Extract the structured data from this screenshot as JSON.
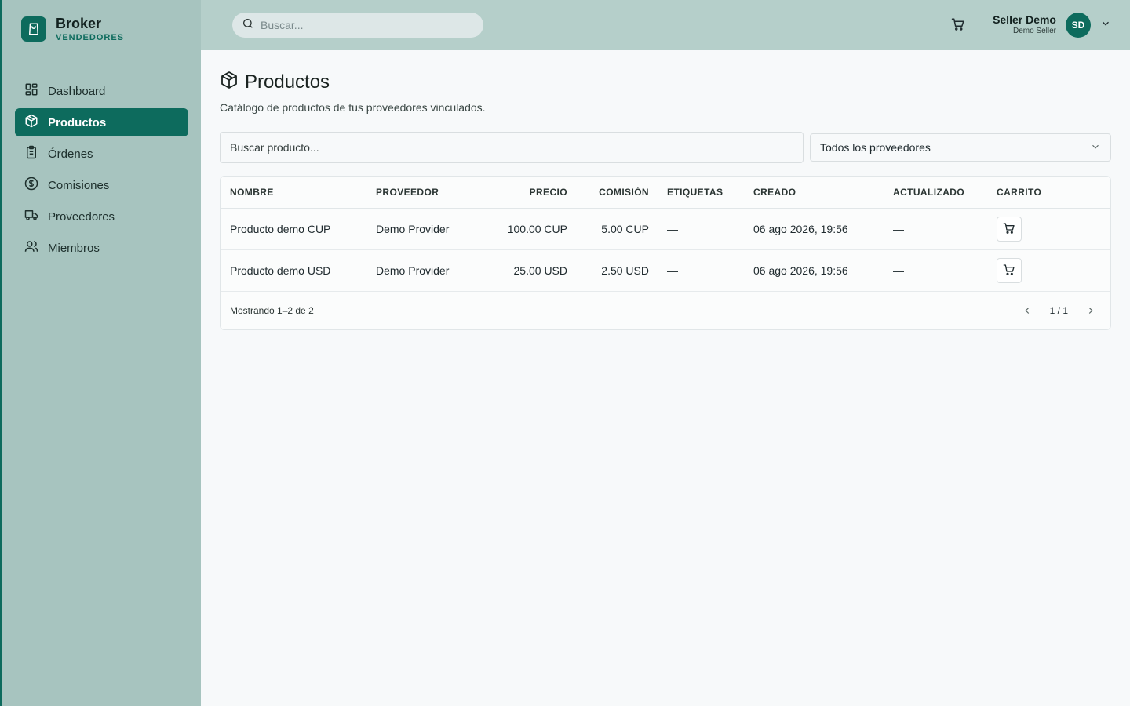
{
  "brand": {
    "name": "Broker",
    "subtitle": "VENDEDORES"
  },
  "sidebar": {
    "items": [
      {
        "label": "Dashboard",
        "icon": "dashboard-icon",
        "active": false
      },
      {
        "label": "Productos",
        "icon": "package-icon",
        "active": true
      },
      {
        "label": "Órdenes",
        "icon": "clipboard-icon",
        "active": false
      },
      {
        "label": "Comisiones",
        "icon": "dollar-circle-icon",
        "active": false
      },
      {
        "label": "Proveedores",
        "icon": "truck-icon",
        "active": false
      },
      {
        "label": "Miembros",
        "icon": "users-icon",
        "active": false
      }
    ]
  },
  "topbar": {
    "search_placeholder": "Buscar...",
    "user": {
      "name": "Seller Demo",
      "role": "Demo Seller",
      "initials": "SD"
    }
  },
  "page": {
    "title": "Productos",
    "description": "Catálogo de productos de tus proveedores vinculados."
  },
  "filters": {
    "search_placeholder": "Buscar producto...",
    "provider_select": "Todos los proveedores"
  },
  "table": {
    "headers": {
      "name": "NOMBRE",
      "provider": "PROVEEDOR",
      "price": "PRECIO",
      "commission": "COMISIÓN",
      "tags": "ETIQUETAS",
      "created": "CREADO",
      "updated": "ACTUALIZADO",
      "cart": "CARRITO"
    },
    "rows": [
      {
        "name": "Producto demo CUP",
        "provider": "Demo Provider",
        "price": "100.00 CUP",
        "commission": "5.00 CUP",
        "tags": "—",
        "created": "06 ago 2026, 19:56",
        "updated": "—"
      },
      {
        "name": "Producto demo USD",
        "provider": "Demo Provider",
        "price": "25.00 USD",
        "commission": "2.50 USD",
        "tags": "—",
        "created": "06 ago 2026, 19:56",
        "updated": "—"
      }
    ],
    "footer": "Mostrando 1–2 de 2",
    "pagination": "1 / 1"
  },
  "colors": {
    "accent": "#0d6b5d",
    "sidebar_bg": "#a7c4bf",
    "topbar_bg": "#b5cfca"
  }
}
